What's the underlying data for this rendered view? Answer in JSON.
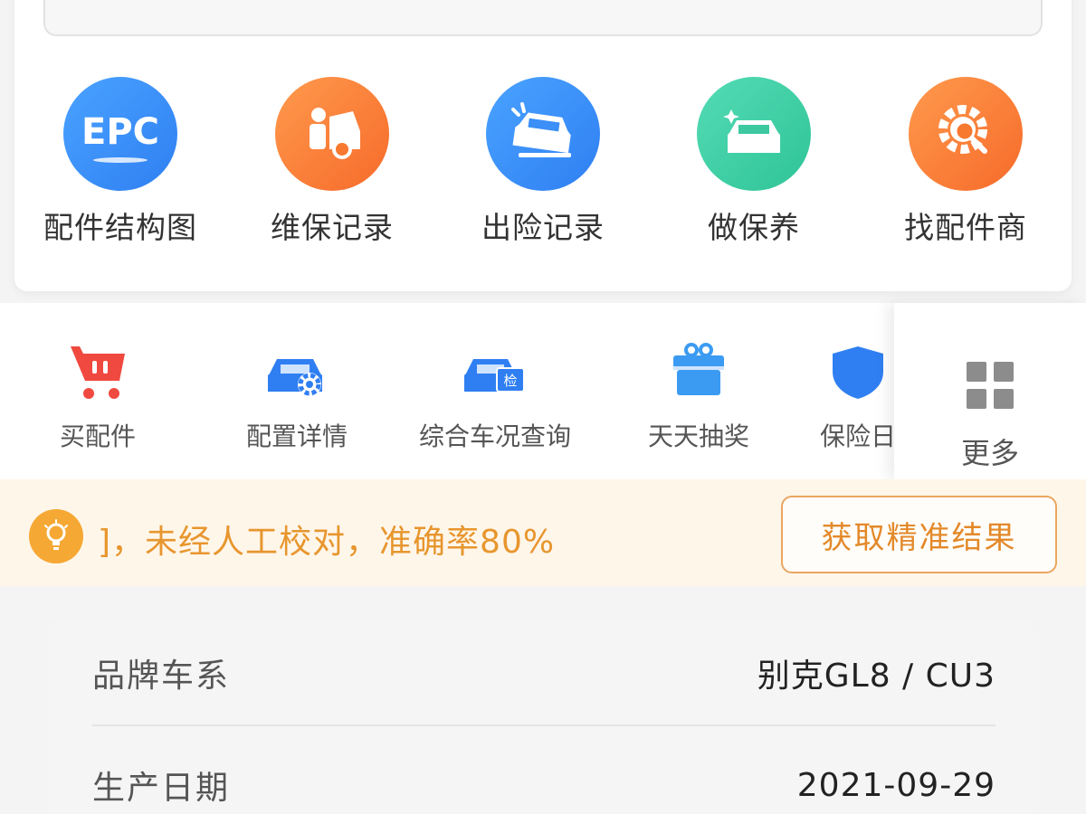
{
  "main_actions": [
    {
      "label": "配件结构图",
      "icon": "epc-icon",
      "color": "#3b8ff7"
    },
    {
      "label": "维保记录",
      "icon": "mechanic-car-icon",
      "color": "#f7782f"
    },
    {
      "label": "出险记录",
      "icon": "car-accident-icon",
      "color": "#3b8ff7"
    },
    {
      "label": "做保养",
      "icon": "car-sparkle-icon",
      "color": "#3cc9a0"
    },
    {
      "label": "找配件商",
      "icon": "gear-search-icon",
      "color": "#f7782f"
    }
  ],
  "epc_text": "EPC",
  "secondary_actions": [
    {
      "label": "买配件",
      "icon": "shopping-cart-icon"
    },
    {
      "label": "配置详情",
      "icon": "car-gear-icon"
    },
    {
      "label": "综合车况查询",
      "icon": "car-inspect-icon",
      "badge": "检"
    },
    {
      "label": "天天抽奖",
      "icon": "gift-icon"
    },
    {
      "label": "保险日",
      "icon": "shield-icon"
    }
  ],
  "more": {
    "label": "更多",
    "icon": "grid-icon"
  },
  "notice": {
    "text": "]，未经人工校对，准确率80%",
    "button": "获取精准结果",
    "icon": "lightbulb-icon"
  },
  "vehicle_info": [
    {
      "label": "品牌车系",
      "value": "别克GL8 / CU3"
    },
    {
      "label": "生产日期",
      "value": "2021-09-29"
    }
  ]
}
